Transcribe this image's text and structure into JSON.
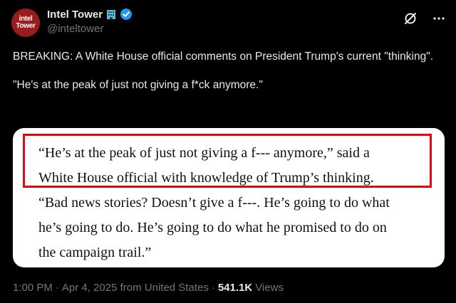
{
  "author": {
    "avatar_line1": "intel",
    "avatar_line2": "Tower",
    "display_name": "Intel Tower",
    "handle": "@inteltower",
    "emoji_icon": "office-building-icon",
    "verified_icon": "verified-badge-icon"
  },
  "top_actions": {
    "grok_icon": "grok-icon",
    "more_icon": "more-icon",
    "more_label": "···"
  },
  "post": {
    "paragraph1": "BREAKING:  A White House official comments on President Trump's current \"thinking\".",
    "paragraph2": "\"He's at the peak of just not giving a f*ck anymore.\""
  },
  "article": {
    "lines": [
      "“He’s at the peak of just not giving a f--- anymore,” said a",
      "White House official with knowledge of Trump’s thinking.",
      "“Bad news stories? Doesn’t give a f---. He’s going to do what",
      "he’s going to do. He’s going to do what he promised to do on",
      "the campaign trail.”"
    ],
    "highlight_color": "#e30613"
  },
  "meta": {
    "time": "1:00 PM",
    "separator1": "·",
    "date": "Apr 4, 2025 from United States",
    "separator2": "·",
    "views_count": "541.1K",
    "views_label": "Views"
  },
  "colors": {
    "background": "#000000",
    "text": "#e7e9ea",
    "secondary": "#71767b",
    "verified": "#1d9bf0"
  }
}
